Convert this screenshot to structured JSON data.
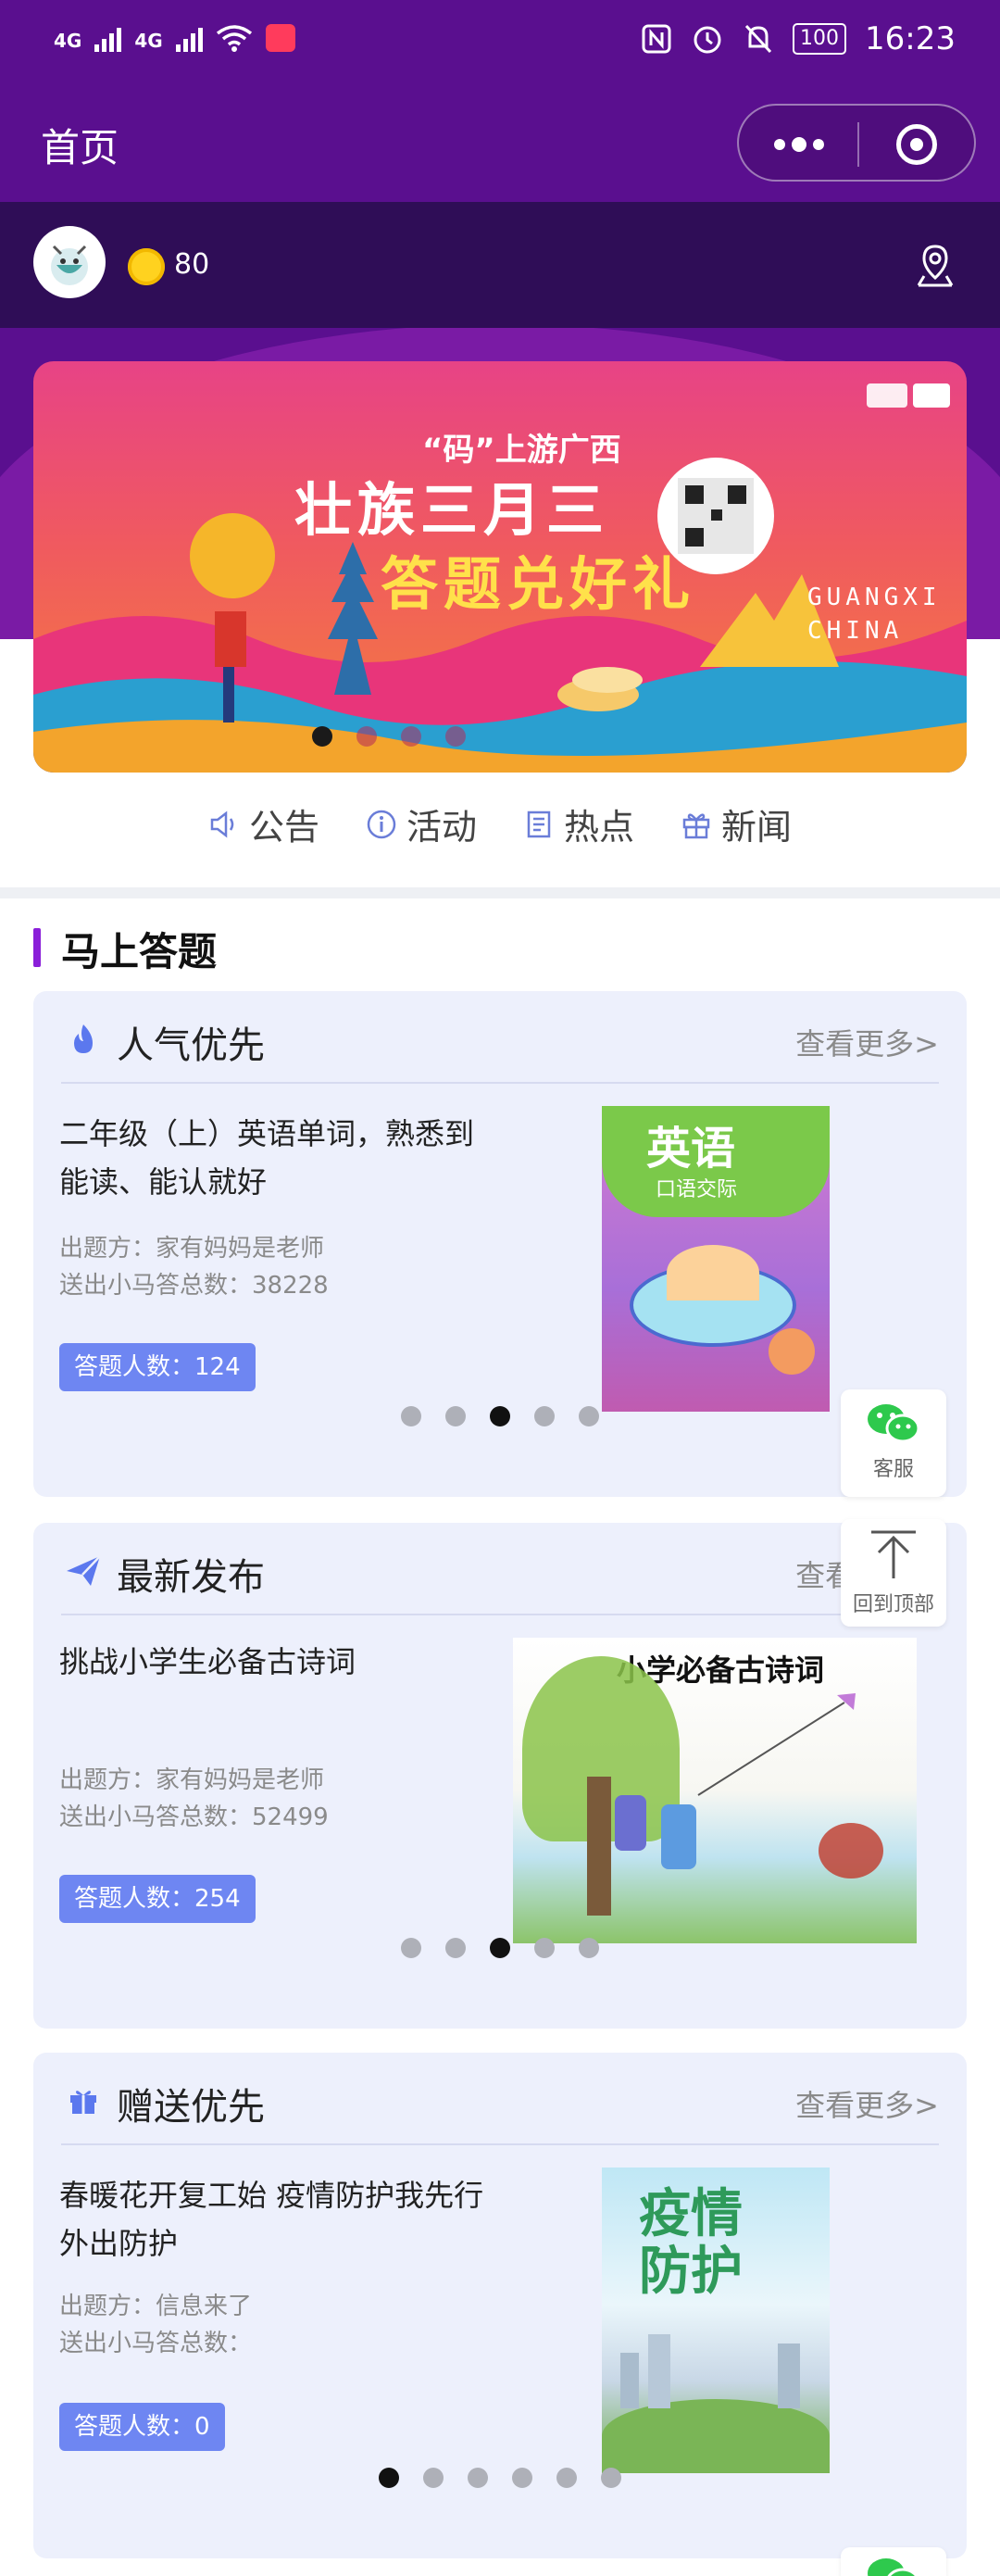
{
  "status_bar": {
    "net1": "4G",
    "net2": "4G",
    "battery": "100",
    "time": "16:23"
  },
  "nav": {
    "title": "首页"
  },
  "user": {
    "coin_count": "80"
  },
  "banner": {
    "headline_small": "“码”上游广西",
    "headline_line1": "壮族三月三",
    "headline_line2": "答题兑好礼",
    "tag_line1": "GUANGXI",
    "tag_line2": "CHINA",
    "slide_count": 4,
    "active_slide": 1
  },
  "menu": {
    "items": [
      {
        "label": "公告",
        "icon": "speaker-icon"
      },
      {
        "label": "活动",
        "icon": "info-icon"
      },
      {
        "label": "热点",
        "icon": "document-icon"
      },
      {
        "label": "新闻",
        "icon": "gift-icon"
      }
    ]
  },
  "section": {
    "title": "马上答题"
  },
  "cards": [
    {
      "title": "人气优先",
      "icon": "flame-icon",
      "more": "查看更多>",
      "quiz_title": "二年级（上）英语单词，熟悉到能读、能认就好",
      "publisher": "出题方：家有妈妈是老师",
      "sent": "送出小马答总数：38228",
      "badge": "答题人数：124",
      "cover_text": "英语",
      "cover_sub": "口语交际",
      "dots": 5,
      "active_dot": 3
    },
    {
      "title": "最新发布",
      "icon": "paper-plane-icon",
      "more": "查看更多>",
      "quiz_title": "挑战小学生必备古诗词",
      "publisher": "出题方：家有妈妈是老师",
      "sent": "送出小马答总数：52499",
      "badge": "答题人数：254",
      "cover_text": "小学必备古诗词",
      "dots": 5,
      "active_dot": 3
    },
    {
      "title": "赠送优先",
      "icon": "gift-box-icon",
      "more": "查看更多>",
      "quiz_title": "春暖花开复工始 疫情防护我先行 外出防护",
      "publisher": "出题方：信息来了",
      "sent": "送出小马答总数：",
      "badge": "答题人数：0",
      "cover_text": "疫情防护",
      "dots": 6,
      "active_dot": 1
    }
  ],
  "floating": {
    "service_label": "客服",
    "top_label": "回到顶部"
  },
  "colors": {
    "header_purple": "#5a0f8f",
    "accent_violet": "#8a1fd9",
    "badge_blue": "#6e86f2",
    "card_bg": "#edf0fc"
  }
}
